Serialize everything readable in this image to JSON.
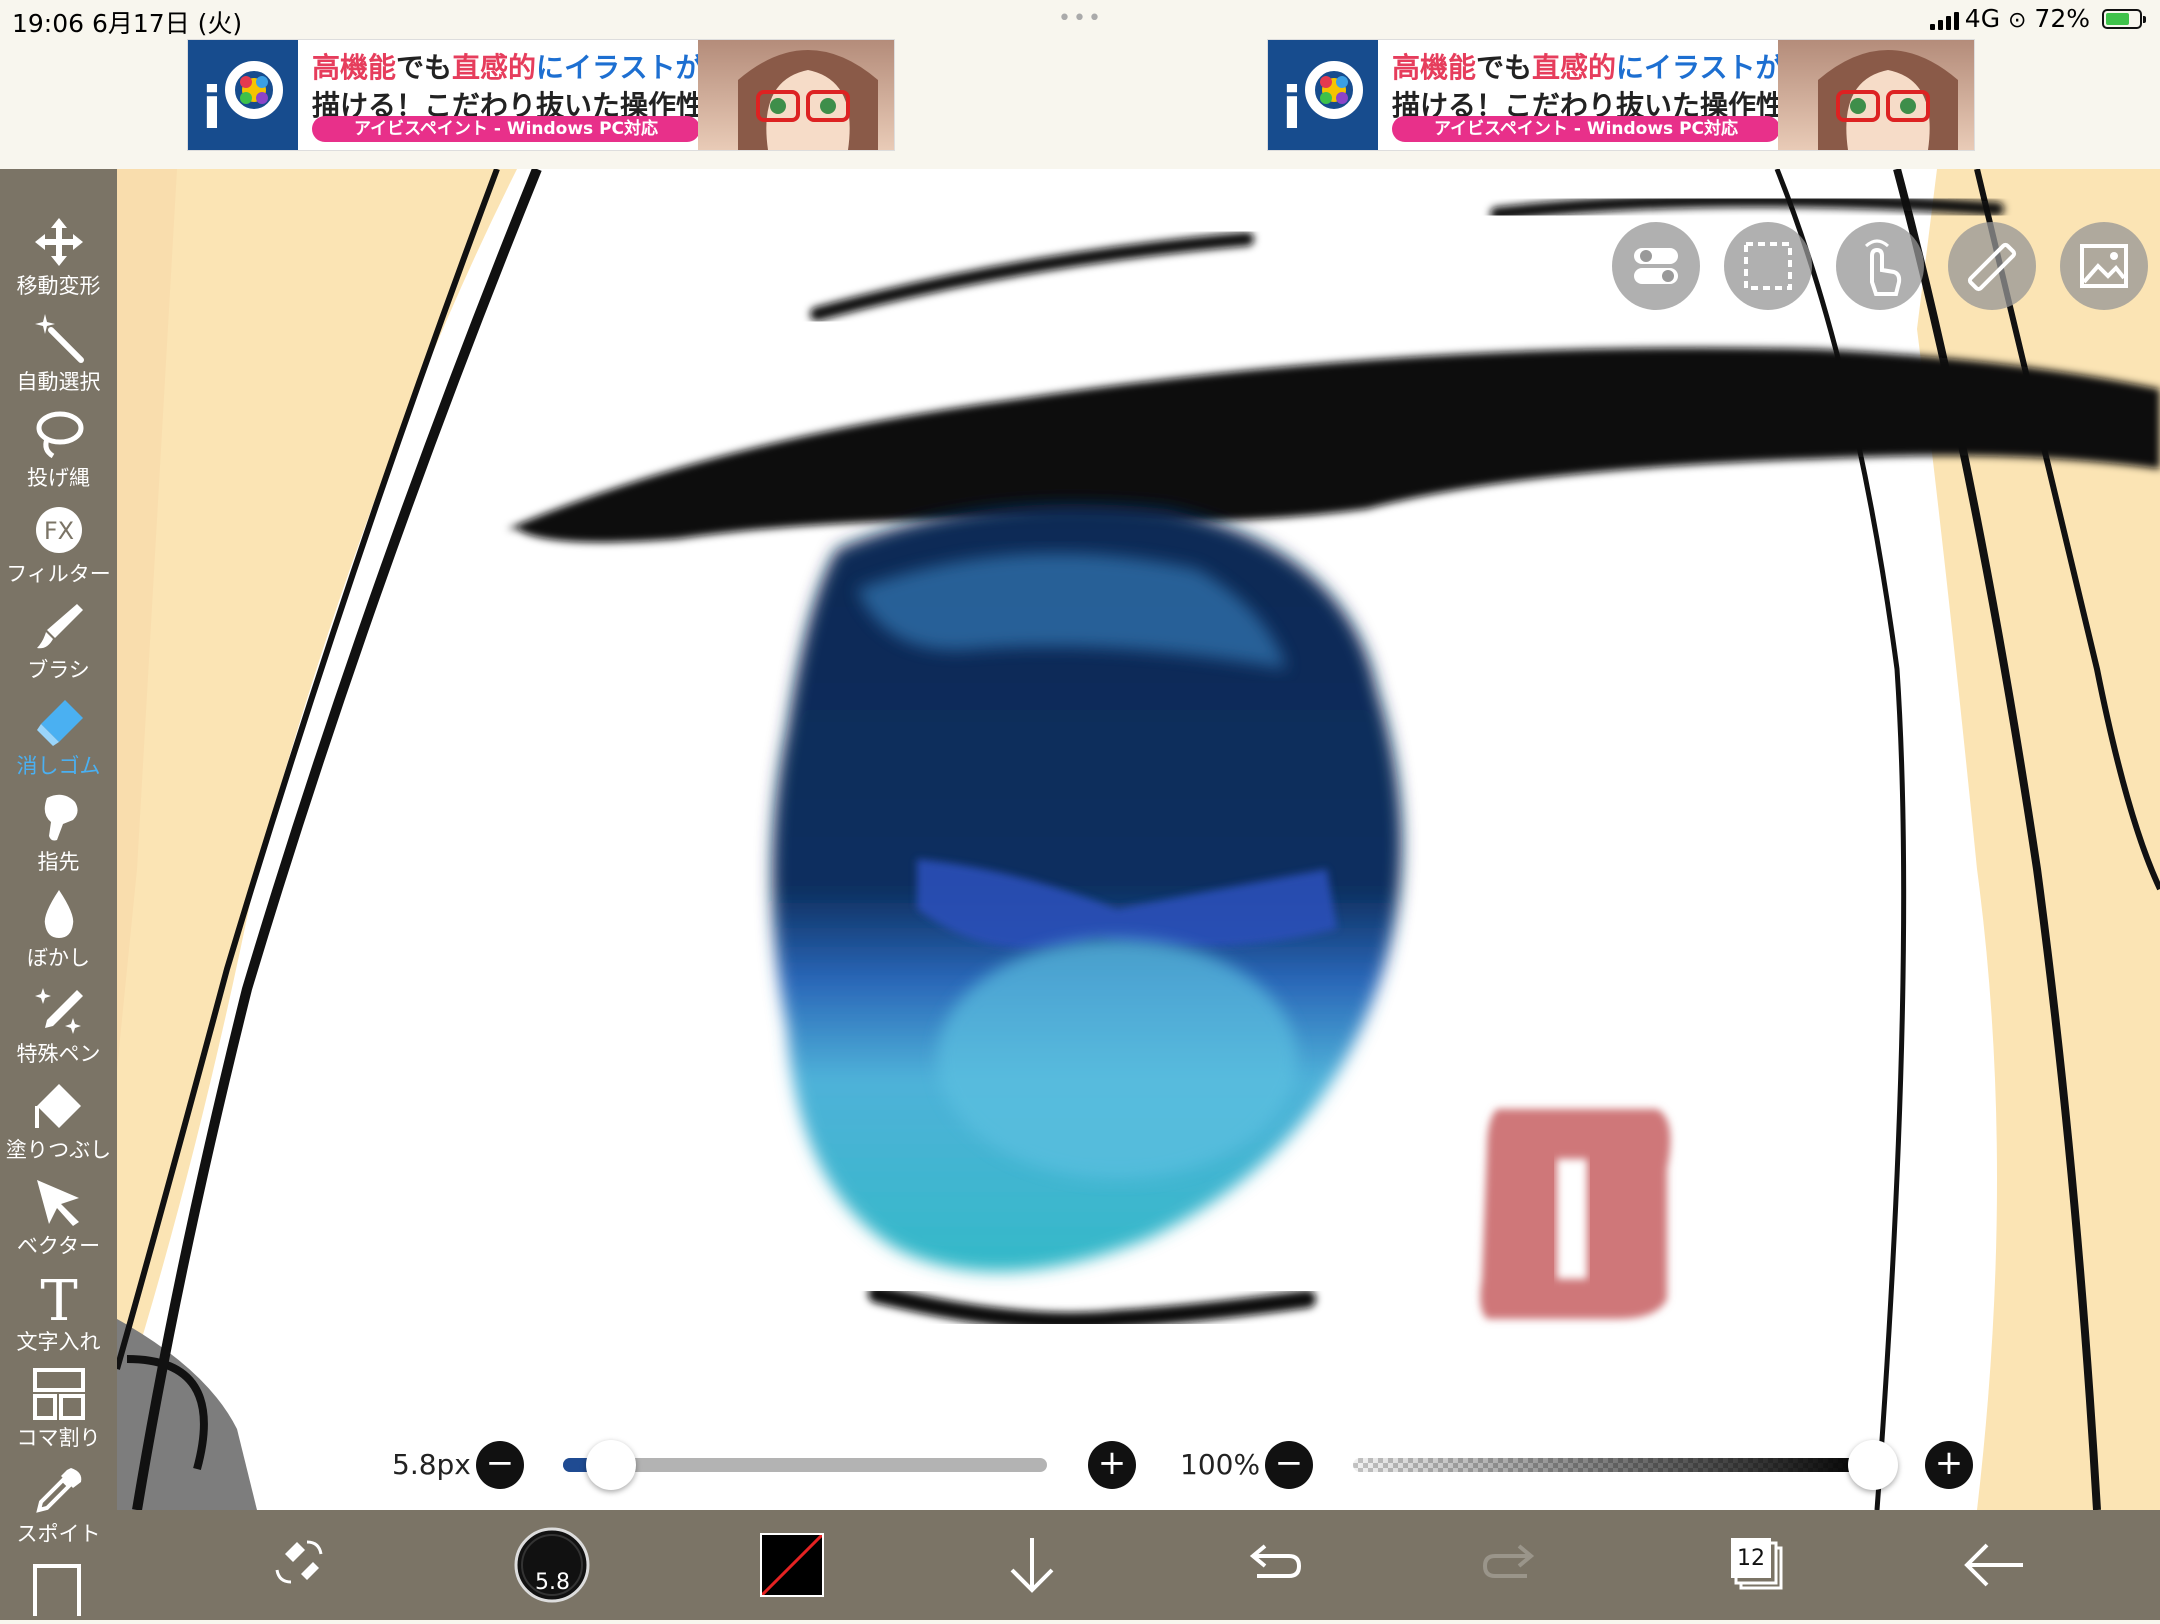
{
  "status_bar": {
    "time_date": "19:06  6月17日 (火)",
    "dots": "•••",
    "network": "4G",
    "battery_text": "72%",
    "battery_level": 0.72,
    "battery_color": "#3fc24a"
  },
  "ads": [
    {
      "line1a": "高機能",
      "line1b": "でも",
      "line1c": "直感的",
      "line1d": "にイラストが",
      "line2": "描ける！こだわり抜いた操作性！",
      "pill": "アイビスペイント - Windows PC対応"
    },
    {
      "line1a": "高機能",
      "line1b": "でも",
      "line1c": "直感的",
      "line1d": "にイラストが",
      "line2": "描ける！こだわり抜いた操作性！",
      "pill": "アイビスペイント - Windows PC対応"
    }
  ],
  "toolbar": {
    "items": [
      {
        "label": "移動変形",
        "icon": "move-transform-icon"
      },
      {
        "label": "自動選択",
        "icon": "magic-wand-icon"
      },
      {
        "label": "投げ縄",
        "icon": "lasso-icon"
      },
      {
        "label": "フィルター",
        "icon": "fx-filter-icon",
        "glyph": "FX"
      },
      {
        "label": "ブラシ",
        "icon": "brush-icon"
      },
      {
        "label": "消しゴム",
        "icon": "eraser-icon",
        "active": true
      },
      {
        "label": "指先",
        "icon": "smudge-finger-icon"
      },
      {
        "label": "ぼかし",
        "icon": "blur-drop-icon"
      },
      {
        "label": "特殊ペン",
        "icon": "special-pen-icon"
      },
      {
        "label": "塗りつぶし",
        "icon": "fill-bucket-icon"
      },
      {
        "label": "ベクター",
        "icon": "vector-arrow-icon"
      },
      {
        "label": "文字入れ",
        "icon": "text-icon",
        "glyph": "T"
      },
      {
        "label": "コマ割り",
        "icon": "frame-divider-icon"
      },
      {
        "label": "スポイト",
        "icon": "eyedropper-icon"
      }
    ],
    "active_color": "#4ab0f2"
  },
  "brush_size": {
    "label": "5.8px",
    "value": 5.8,
    "fraction": 0.1
  },
  "opacity": {
    "label": "100%",
    "value": 100,
    "fraction": 1.0
  },
  "minus": "−",
  "plus": "+",
  "bottom": {
    "brush_badge": "5.8",
    "layer_count": "12",
    "primary_color": "#000000"
  },
  "canvas_colors": {
    "skin": "#fbe4b4",
    "iris_dark": "#0a2a55",
    "iris_light": "#4fb2d9",
    "blush": "#cf7779"
  }
}
